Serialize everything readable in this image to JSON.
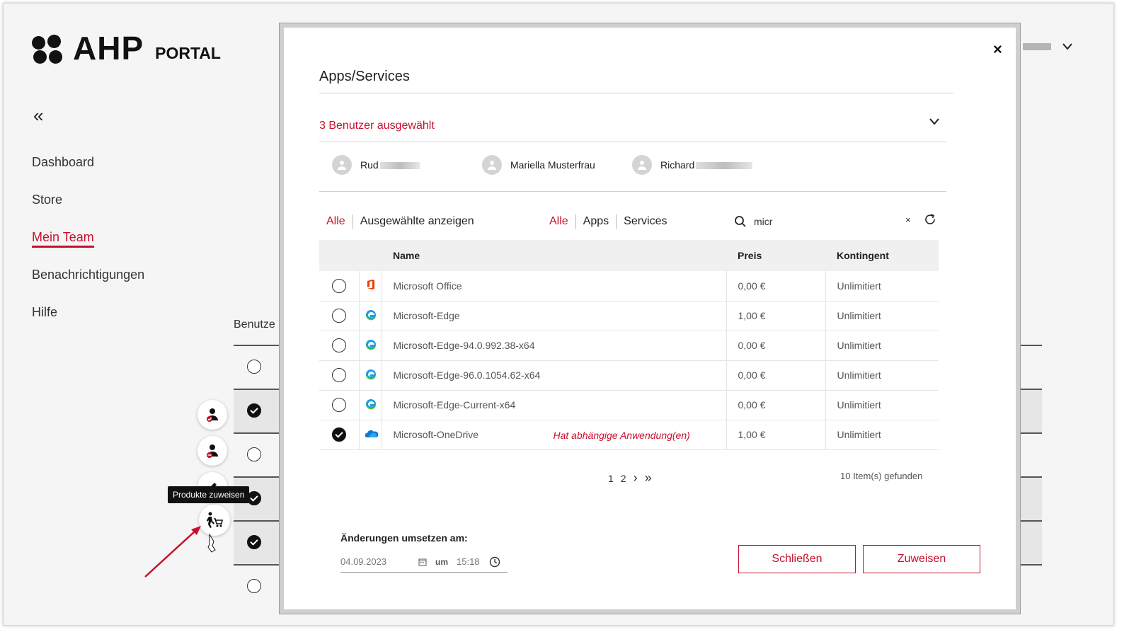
{
  "brand": {
    "mark": "AHP",
    "portal": "PORTAL"
  },
  "sidebar": {
    "collapse_symbol": "«",
    "items": [
      {
        "label": "Dashboard"
      },
      {
        "label": "Store"
      },
      {
        "label": "Mein Team",
        "active": true
      },
      {
        "label": "Benachrichtigungen"
      },
      {
        "label": "Hilfe"
      }
    ]
  },
  "background_table": {
    "header": "Benutze"
  },
  "tooltip": "Produkte zuweisen",
  "modal": {
    "close": "×",
    "title": "Apps/Services",
    "selected_count": "3 Benutzer ausgewählt",
    "users": [
      {
        "name": "Rud"
      },
      {
        "name": "Mariella Musterfrau"
      },
      {
        "name": "Richard"
      }
    ],
    "filter_selection": {
      "all": "Alle",
      "show_selected": "Ausgewählte anzeigen"
    },
    "filter_type": {
      "all": "Alle",
      "apps": "Apps",
      "services": "Services"
    },
    "search": {
      "value": "micr",
      "clear": "×"
    },
    "table": {
      "headers": {
        "name": "Name",
        "price": "Preis",
        "quota": "Kontingent"
      },
      "rows": [
        {
          "name": "Microsoft Office",
          "price": "0,00 €",
          "quota": "Unlimitiert",
          "icon": "office-icon",
          "checked": false,
          "note": ""
        },
        {
          "name": "Microsoft-Edge",
          "price": "1,00 €",
          "quota": "Unlimitiert",
          "icon": "edge-icon",
          "checked": false,
          "note": ""
        },
        {
          "name": "Microsoft-Edge-94.0.992.38-x64",
          "price": "0,00 €",
          "quota": "Unlimitiert",
          "icon": "edge-icon",
          "checked": false,
          "note": ""
        },
        {
          "name": "Microsoft-Edge-96.0.1054.62-x64",
          "price": "0,00 €",
          "quota": "Unlimitiert",
          "icon": "edge-icon",
          "checked": false,
          "note": ""
        },
        {
          "name": "Microsoft-Edge-Current-x64",
          "price": "0,00 €",
          "quota": "Unlimitiert",
          "icon": "edge-icon",
          "checked": false,
          "note": ""
        },
        {
          "name": "Microsoft-OneDrive",
          "price": "1,00 €",
          "quota": "Unlimitiert",
          "icon": "onedrive-icon",
          "checked": true,
          "note": "Hat abhängige Anwendung(en)"
        }
      ]
    },
    "pagination": {
      "p1": "1",
      "p2": "2",
      "next": "›",
      "last": "»"
    },
    "found": "10 Item(s) gefunden",
    "schedule": {
      "label": "Änderungen umsetzen am:",
      "date": "04.09.2023",
      "um": "um",
      "time": "15:18"
    },
    "buttons": {
      "close": "Schließen",
      "assign": "Zuweisen"
    }
  },
  "colors": {
    "accent": "#c8102e",
    "text": "#222222",
    "table_header_bg": "#f0f0f0"
  }
}
